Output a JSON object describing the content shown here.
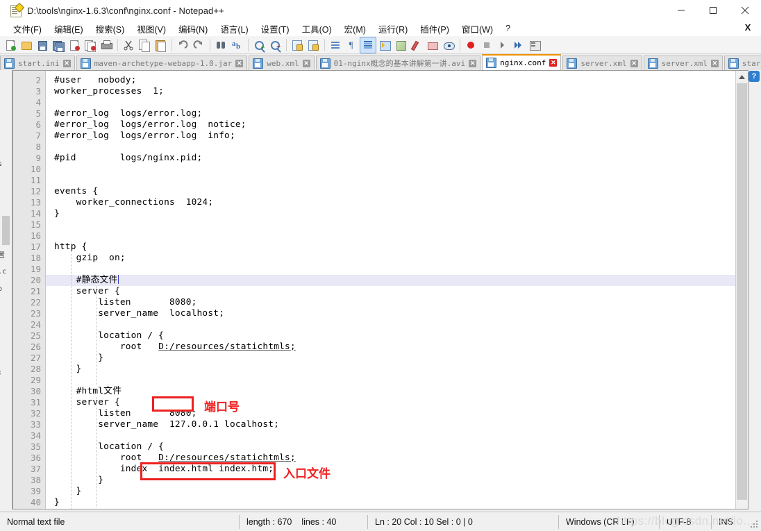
{
  "window": {
    "title": "D:\\tools\\nginx-1.6.3\\conf\\nginx.conf - Notepad++",
    "minimize_label": "—",
    "maximize_label": "☐",
    "close_label": "✕",
    "doc_close_label": "X"
  },
  "menu": {
    "items": [
      {
        "label": "文件(F)"
      },
      {
        "label": "编辑(E)"
      },
      {
        "label": "搜索(S)"
      },
      {
        "label": "视图(V)"
      },
      {
        "label": "编码(N)"
      },
      {
        "label": "语言(L)"
      },
      {
        "label": "设置(T)"
      },
      {
        "label": "工具(O)"
      },
      {
        "label": "宏(M)"
      },
      {
        "label": "运行(R)"
      },
      {
        "label": "插件(P)"
      },
      {
        "label": "窗口(W)"
      },
      {
        "label": "?"
      }
    ]
  },
  "toolbar": {
    "icons": [
      "new-file-icon",
      "open-file-icon",
      "save-icon",
      "save-all-icon",
      "close-file-icon",
      "close-all-icon",
      "print-icon",
      "cut-icon",
      "copy-icon",
      "paste-icon",
      "undo-icon",
      "redo-icon",
      "find-icon",
      "replace-icon",
      "zoom-in-icon",
      "zoom-out-icon",
      "sync-vertical-icon",
      "sync-horizontal-icon",
      "word-wrap-icon",
      "show-pilcrow-icon",
      "show-all-characters-icon",
      "indent-guide-icon",
      "document-map-icon",
      "function-list-icon",
      "folder-as-workspace-icon",
      "monitor-icon",
      "record-macro-icon",
      "stop-macro-icon",
      "play-macro-icon",
      "run-macro-multiple-icon",
      "run-icon"
    ]
  },
  "tabs": {
    "items": [
      {
        "label": "start.ini",
        "active": false
      },
      {
        "label": "maven-archetype-webapp-1.0.jar",
        "active": false
      },
      {
        "label": "web.xml",
        "active": false
      },
      {
        "label": "01-nginx概念的基本讲解第一讲.avi",
        "active": false
      },
      {
        "label": "nginx.conf",
        "active": true
      },
      {
        "label": "server.xml",
        "active": false
      },
      {
        "label": "server.xml",
        "active": false
      },
      {
        "label": "startup.bat",
        "active": false
      }
    ],
    "close_label": "✕",
    "scroll_left_label": "◀",
    "scroll_right_label": "▶"
  },
  "left_dock": {
    "sliver_lines": [
      "置",
      ".c",
      "o",
      "s",
      ";"
    ]
  },
  "editor": {
    "first_line_number": 2,
    "current_line": 20,
    "lines": [
      {
        "n": 2,
        "text": "#user   nobody;"
      },
      {
        "n": 3,
        "text": "worker_processes  1;"
      },
      {
        "n": 4,
        "text": ""
      },
      {
        "n": 5,
        "text": "#error_log  logs/error.log;"
      },
      {
        "n": 6,
        "text": "#error_log  logs/error.log  notice;"
      },
      {
        "n": 7,
        "text": "#error_log  logs/error.log  info;"
      },
      {
        "n": 8,
        "text": ""
      },
      {
        "n": 9,
        "text": "#pid        logs/nginx.pid;"
      },
      {
        "n": 10,
        "text": ""
      },
      {
        "n": 11,
        "text": ""
      },
      {
        "n": 12,
        "text": "events {"
      },
      {
        "n": 13,
        "text": "    worker_connections  1024;"
      },
      {
        "n": 14,
        "text": "}"
      },
      {
        "n": 15,
        "text": ""
      },
      {
        "n": 16,
        "text": ""
      },
      {
        "n": 17,
        "text": "http {"
      },
      {
        "n": 18,
        "text": "    gzip  on;"
      },
      {
        "n": 19,
        "text": ""
      },
      {
        "n": 20,
        "text": "    #静态文件"
      },
      {
        "n": 21,
        "text": "    server {"
      },
      {
        "n": 22,
        "text": "        listen       8080;"
      },
      {
        "n": 23,
        "text": "        server_name  localhost;"
      },
      {
        "n": 24,
        "text": ""
      },
      {
        "n": 25,
        "text": "        location / {"
      },
      {
        "n": 26,
        "text": "            root   D:/resources/statichtmls;"
      },
      {
        "n": 27,
        "text": "        }"
      },
      {
        "n": 28,
        "text": "    }"
      },
      {
        "n": 29,
        "text": ""
      },
      {
        "n": 30,
        "text": "    #html文件"
      },
      {
        "n": 31,
        "text": "    server {"
      },
      {
        "n": 32,
        "text": "        listen       8080;"
      },
      {
        "n": 33,
        "text": "        server_name  127.0.0.1 localhost;"
      },
      {
        "n": 34,
        "text": ""
      },
      {
        "n": 35,
        "text": "        location / {"
      },
      {
        "n": 36,
        "text": "            root   D:/resources/statichtmls;"
      },
      {
        "n": 37,
        "text": "            index  index.html index.htm;"
      },
      {
        "n": 38,
        "text": "        }"
      },
      {
        "n": 39,
        "text": "    }"
      },
      {
        "n": 40,
        "text": "}"
      }
    ],
    "annotations": [
      {
        "name": "port-annotation",
        "label": "端口号"
      },
      {
        "name": "entry-file-annotation",
        "label": "入口文件"
      }
    ]
  },
  "status": {
    "file_type": "Normal text file",
    "length": "length : 670",
    "lines": "lines : 40",
    "position": "Ln : 20    Col : 10    Sel : 0 | 0",
    "eol": "Windows (CR LF)",
    "encoding": "UTF-8",
    "insert_mode": "INS"
  },
  "watermark": "https://blog.csdn.net/lo...",
  "help_badge": "?"
}
